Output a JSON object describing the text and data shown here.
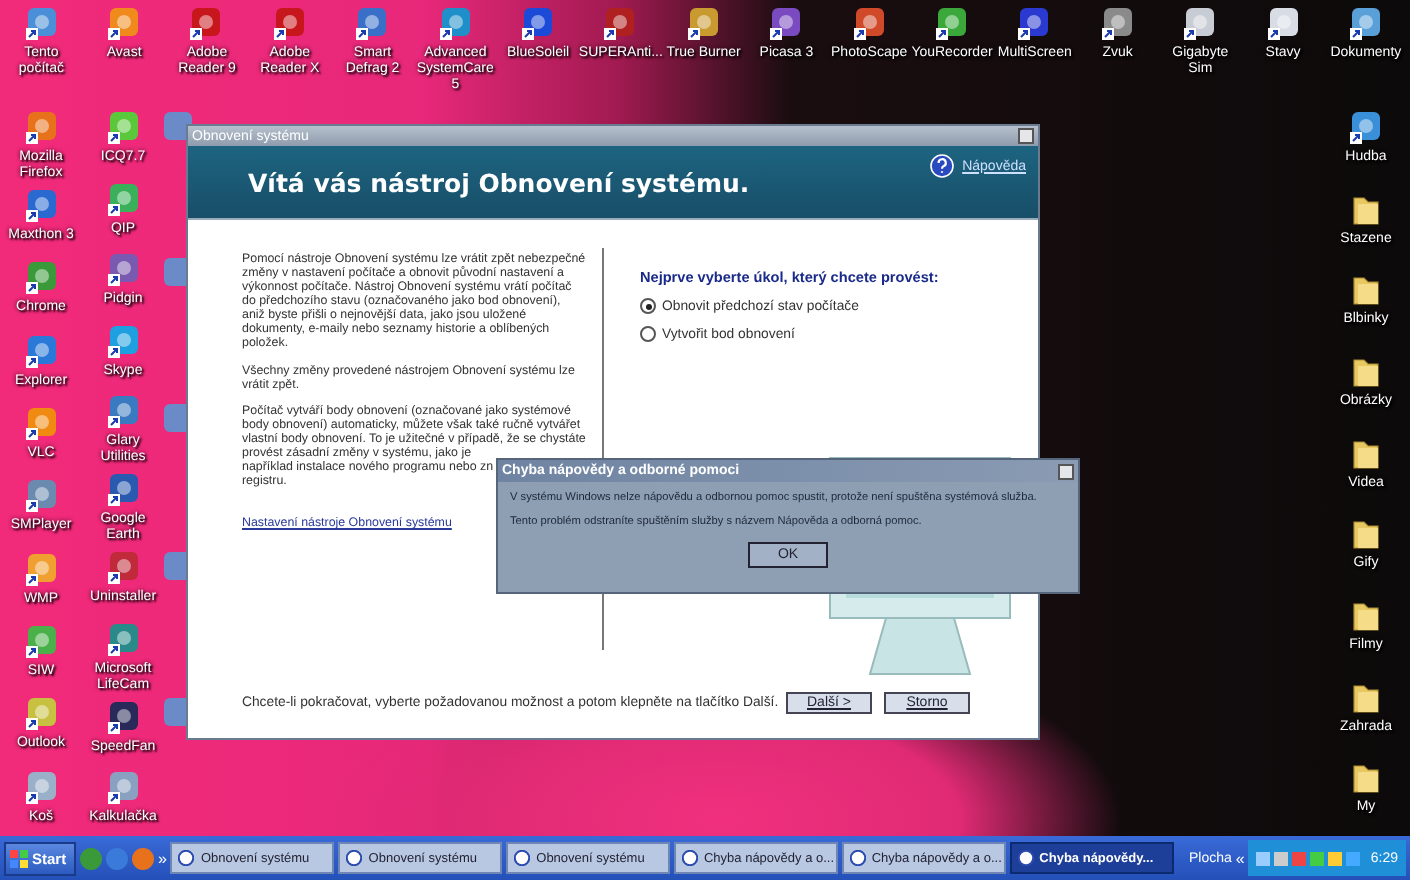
{
  "desktop": {
    "top_row": [
      {
        "label": "Tento počítač",
        "kind": "app",
        "color": "#4a8fd8"
      },
      {
        "label": "Avast",
        "kind": "app",
        "color": "#f08a1c"
      },
      {
        "label": "Adobe Reader 9",
        "kind": "app",
        "color": "#c8161d"
      },
      {
        "label": "Adobe Reader X",
        "kind": "app",
        "color": "#c8161d"
      },
      {
        "label": "Smart Defrag 2",
        "kind": "app",
        "color": "#3a6fc8"
      },
      {
        "label": "Advanced SystemCare 5",
        "kind": "app",
        "color": "#1e8fc8"
      },
      {
        "label": "BlueSoleil",
        "kind": "app",
        "color": "#1c4ad8"
      },
      {
        "label": "SUPERAnti...",
        "kind": "app",
        "color": "#b02020"
      },
      {
        "label": "True Burner",
        "kind": "app",
        "color": "#c89a30"
      },
      {
        "label": "Picasa 3",
        "kind": "app",
        "color": "#7a4ac0"
      },
      {
        "label": "PhotoScape",
        "kind": "app",
        "color": "#d04a2a"
      },
      {
        "label": "YouRecorder",
        "kind": "app",
        "color": "#3aa83a"
      },
      {
        "label": "MultiScreen",
        "kind": "app",
        "color": "#2a3ad0"
      },
      {
        "label": "Zvuk",
        "kind": "app",
        "color": "#8a8a8a"
      },
      {
        "label": "Gigabyte Sim",
        "kind": "app",
        "color": "#c8ccd4"
      },
      {
        "label": "Stavy",
        "kind": "app",
        "color": "#d8dce4"
      },
      {
        "label": "Dokumenty",
        "kind": "app",
        "color": "#5aa0d8"
      }
    ],
    "left_column_1": [
      {
        "label": "Mozilla Firefox",
        "kind": "app",
        "color": "#e8721c"
      },
      {
        "label": "Maxthon 3",
        "kind": "app",
        "color": "#2a6ad0"
      },
      {
        "label": "Chrome",
        "kind": "app",
        "color": "#3a9a3a"
      },
      {
        "label": "Explorer",
        "kind": "app",
        "color": "#2a78d8"
      },
      {
        "label": "VLC",
        "kind": "app",
        "color": "#f08a10"
      },
      {
        "label": "SMPlayer",
        "kind": "app",
        "color": "#6a8ab0"
      },
      {
        "label": "WMP",
        "kind": "app",
        "color": "#f0a030"
      },
      {
        "label": "SIW",
        "kind": "app",
        "color": "#4ab04a"
      },
      {
        "label": "Outlook",
        "kind": "app",
        "color": "#c8c040"
      },
      {
        "label": "Koš",
        "kind": "app",
        "color": "#9ab0c8"
      }
    ],
    "left_column_2": [
      {
        "label": "ICQ7.7",
        "kind": "app",
        "color": "#5ac83a"
      },
      {
        "label": "QIP",
        "kind": "app",
        "color": "#3ab05a"
      },
      {
        "label": "Pidgin",
        "kind": "app",
        "color": "#7a5ab0"
      },
      {
        "label": "Skype",
        "kind": "app",
        "color": "#1ea0e0"
      },
      {
        "label": "Glary Utilities",
        "kind": "app",
        "color": "#3a7ac0"
      },
      {
        "label": "Google Earth",
        "kind": "app",
        "color": "#2a5ab0"
      },
      {
        "label": "Uninstaller",
        "kind": "app",
        "color": "#c02a3a"
      },
      {
        "label": "Microsoft LifeCam",
        "kind": "app",
        "color": "#2a8a8a"
      },
      {
        "label": "SpeedFan",
        "kind": "app",
        "color": "#2a2a5a"
      },
      {
        "label": "Kalkulačka",
        "kind": "app",
        "color": "#8aa0c0"
      }
    ],
    "right_column": [
      {
        "label": "Hudba",
        "kind": "app",
        "color": "#3a90d8"
      },
      {
        "label": "Stazene",
        "kind": "folder"
      },
      {
        "label": "Blbinky",
        "kind": "folder"
      },
      {
        "label": "Obrázky",
        "kind": "folder"
      },
      {
        "label": "Videa",
        "kind": "folder"
      },
      {
        "label": "Gify",
        "kind": "folder"
      },
      {
        "label": "Filmy",
        "kind": "folder"
      },
      {
        "label": "Zahrada",
        "kind": "folder"
      },
      {
        "label": "My",
        "kind": "folder"
      }
    ]
  },
  "restore_window": {
    "title": "Obnovení systému",
    "heading": "Vítá vás nástroj Obnovení systému.",
    "help_link": "Nápověda",
    "paragraphs": [
      "Pomocí nástroje Obnovení systému lze vrátit zpět nebezpečné změny v nastavení počítače a obnovit původní nastavení a výkonnost počítače. Nástroj Obnovení systému vrátí počítač do předchozího stavu (označovaného jako bod obnovení), aniž byste přišli o nejnovější data, jako jsou uložené dokumenty, e-maily nebo seznamy historie a oblíbených položek.",
      "Všechny změny provedené nástrojem Obnovení systému lze vrátit zpět.",
      "Počítač vytváří body obnovení (označované jako systémové body obnovení) automaticky, můžete však také ručně vytvářet vlastní body obnovení. To je užitečné v případě, že se chystáte provést zásadní změny v systému, jako je"
    ],
    "paragraph_tail": [
      "například instalace nového programu nebo zn",
      "registru."
    ],
    "settings_link": "Nastavení nástroje Obnovení systému",
    "task_prompt": "Nejprve vyberte úkol, který chcete provést:",
    "options": [
      {
        "label": "Obnovit předchozí stav počítače",
        "selected": true
      },
      {
        "label": "Vytvořit bod obnovení",
        "selected": false
      }
    ],
    "footer_text": "Chcete-li pokračovat, vyberte požadovanou možnost a potom klepněte na tlačítko Další.",
    "buttons": [
      "Další >",
      "Storno"
    ]
  },
  "error_dialog": {
    "title": "Chyba nápovědy a odborné pomoci",
    "lines": [
      "V systému Windows nelze nápovědu a odbornou pomoc spustit, protože není spuštěna systémová služba.",
      "Tento problém odstraníte spuštěním služby s názvem Nápověda a odborná pomoc."
    ],
    "button": "OK"
  },
  "taskbar": {
    "start": "Start",
    "quick_launch_more": "»",
    "tasks": [
      {
        "label": "Obnovení systému",
        "selected": false
      },
      {
        "label": "Obnovení systému",
        "selected": false
      },
      {
        "label": "Obnovení systému",
        "selected": false
      },
      {
        "label": "Chyba nápovědy a o...",
        "selected": false
      },
      {
        "label": "Chyba nápovědy a o...",
        "selected": false
      },
      {
        "label": "Chyba nápovědy...",
        "selected": true
      }
    ],
    "toolbar": "Plocha",
    "tray_expand": "«",
    "clock": "6:29"
  }
}
